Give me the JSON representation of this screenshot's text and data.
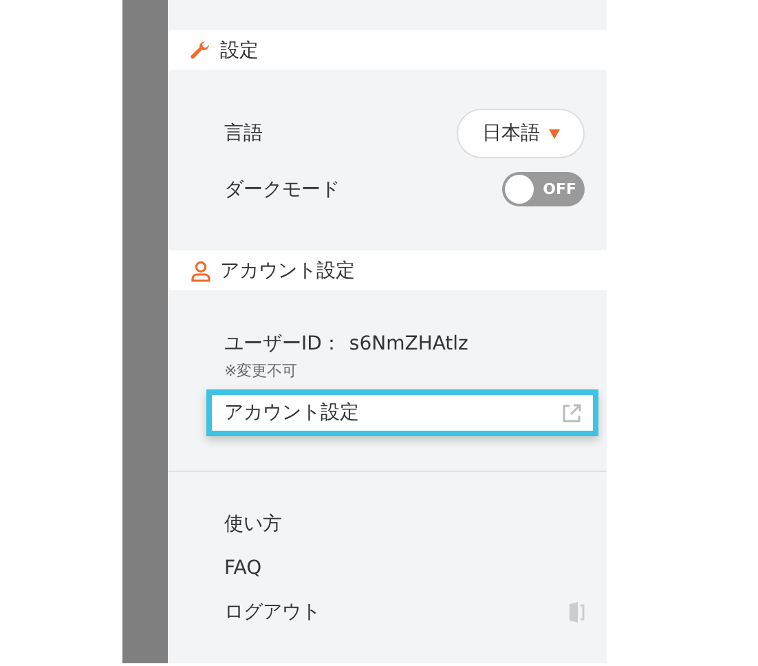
{
  "settings_section": {
    "title": "設定",
    "language": {
      "label": "言語",
      "value": "日本語"
    },
    "dark_mode": {
      "label": "ダークモード",
      "on": false,
      "state_text": "OFF"
    }
  },
  "account_section": {
    "title": "アカウント設定",
    "user_id_label": "ユーザーID：",
    "user_id": "s6NmZHAtlz",
    "note": "※変更不可",
    "account_link": {
      "label": "アカウント設定",
      "highlighted": true
    }
  },
  "menu": [
    {
      "label": "使い方",
      "kind": "plain"
    },
    {
      "label": "FAQ",
      "kind": "plain"
    },
    {
      "label": "ログアウト",
      "kind": "logout"
    }
  ]
}
